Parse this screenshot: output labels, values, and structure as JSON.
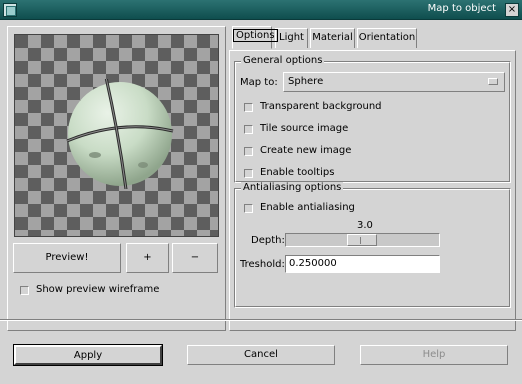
{
  "window": {
    "title": "Map to object",
    "close_glyph": "×"
  },
  "left": {
    "buttons": {
      "preview": "Preview!",
      "zoom_in": "+",
      "zoom_out": "−"
    },
    "show_wireframe": {
      "label": "Show preview wireframe",
      "checked": false
    }
  },
  "tabs": [
    "Options",
    "Light",
    "Material",
    "Orientation"
  ],
  "general": {
    "title": "General options",
    "map_to_label": "Map to:",
    "map_to_value": "Sphere",
    "transparent_background": {
      "label": "Transparent background",
      "checked": false
    },
    "tile_source_image": {
      "label": "Tile source image",
      "checked": false
    },
    "create_new_image": {
      "label": "Create new image",
      "checked": false
    },
    "enable_tooltips": {
      "label": "Enable tooltips",
      "checked": false
    }
  },
  "antialiasing": {
    "title": "Antialiasing options",
    "enable": {
      "label": "Enable antialiasing",
      "checked": false
    },
    "depth_label": "Depth:",
    "depth_value": "3.0",
    "depth_level": 3.0,
    "threshold_label": "Treshold:",
    "threshold_value": "0.250000"
  },
  "footer": {
    "apply": "Apply",
    "cancel": "Cancel",
    "help": "Help"
  },
  "colors": {
    "titlebar": "#1f5f5f",
    "sphere": "#c9dcc6"
  }
}
